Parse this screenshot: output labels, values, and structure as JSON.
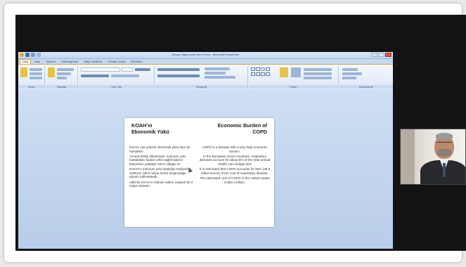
{
  "window": {
    "title": "Dünya Sigarasızlık Günü Sunu - Microsoft PowerPoint"
  },
  "ribbon": {
    "tabs": [
      "Giriş",
      "Ekle",
      "Tasarım",
      "Animasyonlar",
      "Slayt Gösterisi",
      "Gözden Geçir",
      "Görünüm"
    ],
    "groups": [
      "Pano",
      "Slaytlar",
      "Yazı Tipi",
      "Paragraf",
      "Çizim",
      "Düzenleme"
    ]
  },
  "slide": {
    "left": {
      "title_line1": "KOAH’ın",
      "title_line2": "Ekonomik Yükü",
      "p1": "KOAH, çok yüksek ekonomik yükü olan bir hastalıktır.",
      "p2": "Avrupa Birliği ülkelerinde, solunum yolu hastalıkları toplam yıllık sağlık bakımı bütçesinin yaklaşık %6’sı olduğu ve",
      "p3": "KOAH’ın solunum yolu hastalığı maliyetinin %56’sını (38,6 milyar Euro) oluşturduğu tahmin edilmektedir.",
      "p4": "ABD’de KOAH’ın tahmin edilen maliyeti 52.4 milyar dolardır."
    },
    "right": {
      "title_line1": "Economic Burden of",
      "title_line2": "COPD",
      "p1": "COPD is a disease with a very high economic burden.",
      "p2": "In the European Union countries, respiratory diseases account for about 6% of the total annual health care budget and",
      "p3": "It is estimated that COPD accounts for 56% (38.6 billion Euros) of the cost of respiratory disease.",
      "p4": "The estimated cost of COPD in the United States is $52.4 billion."
    }
  },
  "colors": {
    "ribbon_blue": "#c7d8ef",
    "tab_highlight": "#c9a94f",
    "viewer_background": "#131313"
  }
}
